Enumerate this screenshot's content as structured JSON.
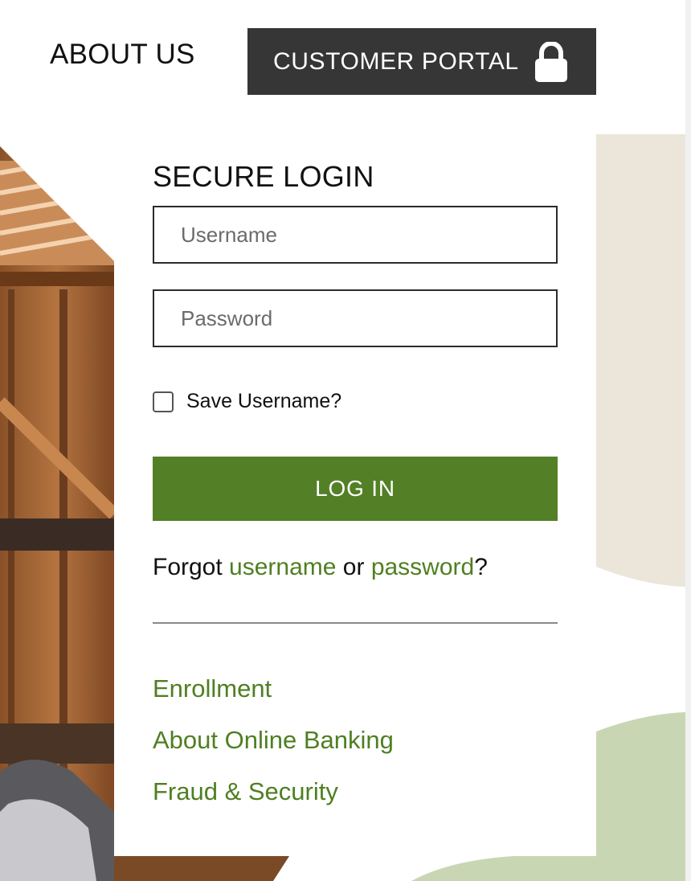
{
  "nav": {
    "about_label": "ABOUT US",
    "portal_label": "CUSTOMER PORTAL",
    "portal_icon": "lock-icon"
  },
  "login": {
    "title": "SECURE LOGIN",
    "username_placeholder": "Username",
    "username_value": "",
    "password_placeholder": "Password",
    "password_value": "",
    "save_username_label": "Save Username?",
    "save_username_checked": false,
    "login_button_label": "LOG IN",
    "forgot": {
      "prefix": "Forgot ",
      "username_link": "username",
      "middle": " or ",
      "password_link": "password",
      "suffix": "?"
    }
  },
  "links": [
    "Enrollment",
    "About Online Banking",
    "Fraud & Security"
  ],
  "colors": {
    "accent_green": "#537f26",
    "link_green": "#4f7f22",
    "portal_button": "#363636",
    "beige_shape": "#ece6da",
    "sage_shape": "#c9d6b3"
  }
}
